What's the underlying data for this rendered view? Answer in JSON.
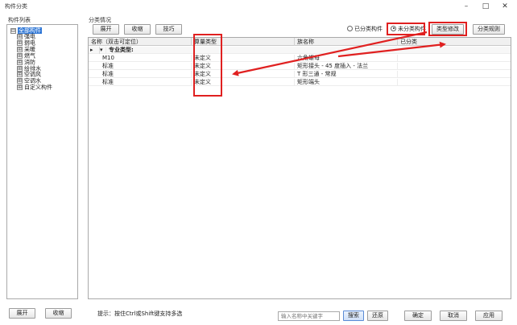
{
  "window": {
    "title": "构件分类",
    "minimize": "–",
    "maximize": "□",
    "close": "✕"
  },
  "left_panel": {
    "label": "构件列表",
    "root": {
      "expander": "⊟",
      "label": "全部构件"
    },
    "items": [
      {
        "expander": "⊞",
        "label": "强电"
      },
      {
        "expander": "⊞",
        "label": "弱电"
      },
      {
        "expander": "⊞",
        "label": "采暖"
      },
      {
        "expander": "⊞",
        "label": "燃气"
      },
      {
        "expander": "⊞",
        "label": "消防"
      },
      {
        "expander": "⊞",
        "label": "给排水"
      },
      {
        "expander": "⊞",
        "label": "空调风"
      },
      {
        "expander": "⊞",
        "label": "空调水"
      },
      {
        "expander": "⊞",
        "label": "自定义构件"
      }
    ],
    "expand_button": "展开",
    "collapse_button": "收缩"
  },
  "right_panel": {
    "label": "分类情况",
    "expand_button": "展开",
    "collapse_button": "收缩",
    "tips_button": "技巧",
    "radio_classified": "已分类构件",
    "radio_unclassified": "未分类构件",
    "type_modify_button": "类型修改",
    "classify_rules_button": "分类规则"
  },
  "table": {
    "columns": [
      "名称（双击可定位）",
      "算量类型",
      "族名称",
      "已分类"
    ],
    "group": {
      "marker": "▸",
      "toggle": "▾",
      "label": "专业类型:"
    },
    "rows": [
      {
        "name": "M10",
        "calc_type": "未定义",
        "family": "六角螺母",
        "classified": ""
      },
      {
        "name": "标准",
        "calc_type": "未定义",
        "family": "矩形接头 - 45 度插入 - 法兰",
        "classified": ""
      },
      {
        "name": "标准",
        "calc_type": "未定义",
        "family": "T 形三通 - 常规",
        "classified": ""
      },
      {
        "name": "标准",
        "calc_type": "未定义",
        "family": "矩形端头",
        "classified": ""
      }
    ]
  },
  "footer": {
    "hint": "提示：按住Ctrl或Shift键支持多选",
    "search_placeholder": "输入名称中关键字",
    "search_button": "搜索",
    "restore_button": "还原",
    "ok_button": "确定",
    "cancel_button": "取消",
    "apply_button": "应用"
  },
  "colors": {
    "annotation_red": "#e02020",
    "selection_blue": "#3178d6"
  }
}
